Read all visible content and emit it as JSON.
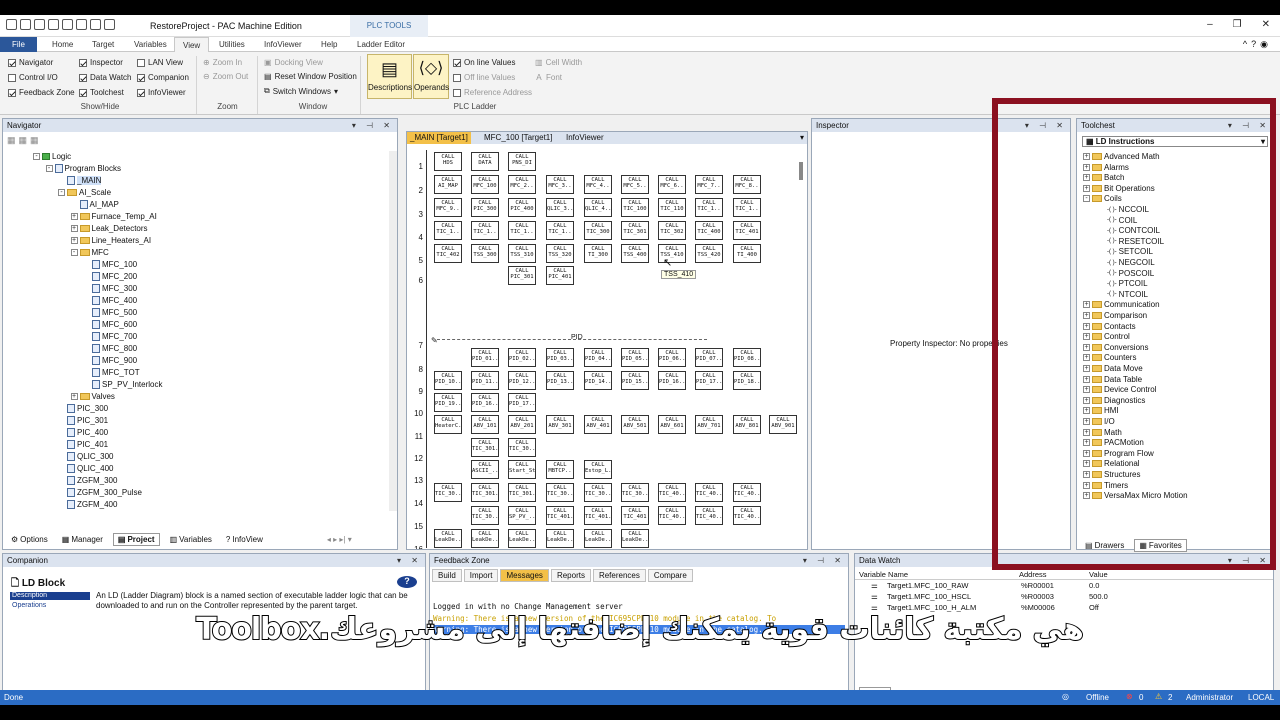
{
  "app": {
    "title": "RestoreProject - PAC Machine Edition",
    "plc_tools": "PLC TOOLS"
  },
  "ribbon_tabs": [
    "File",
    "Home",
    "Target",
    "Variables",
    "View",
    "Utilities",
    "InfoViewer",
    "Help",
    "Ladder Editor"
  ],
  "ribbon": {
    "show_hide": {
      "items": [
        "Navigator",
        "Control I/O",
        "Feedback Zone",
        "Inspector",
        "Data Watch",
        "Toolchest",
        "LAN View",
        "Companion",
        "InfoViewer"
      ],
      "label": "Show/Hide"
    },
    "zoom": {
      "items": [
        "Zoom In",
        "Zoom Out"
      ],
      "label": "Zoom"
    },
    "window": {
      "items": [
        "Docking View",
        "Reset Window Position",
        "Switch Windows"
      ],
      "label": "Window"
    },
    "plc_ladder": {
      "descriptions": "Descriptions",
      "operands": "Operands",
      "items": [
        "On line Values",
        "Off line Values",
        "Reference Address",
        "Cell Width",
        "Font"
      ],
      "label": "PLC Ladder"
    }
  },
  "navigator": {
    "title": "Navigator",
    "items": [
      "Logic",
      "Program Blocks",
      "_MAIN",
      "AI_Scale",
      "AI_MAP",
      "Furnace_Temp_AI",
      "Leak_Detectors",
      "Line_Heaters_AI",
      "MFC",
      "MFC_100",
      "MFC_200",
      "MFC_300",
      "MFC_400",
      "MFC_500",
      "MFC_600",
      "MFC_700",
      "MFC_800",
      "MFC_900",
      "MFC_TOT",
      "SP_PV_Interlock",
      "Valves",
      "PIC_300",
      "PIC_301",
      "PIC_400",
      "PIC_401",
      "QLIC_300",
      "QLIC_400",
      "ZGFM_300",
      "ZGFM_300_Pulse",
      "ZGFM_400"
    ],
    "tabs": [
      "Options",
      "Manager",
      "Project",
      "Variables",
      "InfoView"
    ]
  },
  "ladder": {
    "tabs": [
      "_MAIN [Target1]",
      "MFC_100 [Target1]",
      "InfoViewer"
    ],
    "rungs": [
      "1",
      "2",
      "3",
      "4",
      "5",
      "6",
      "7",
      "8",
      "9",
      "10",
      "11",
      "12",
      "13",
      "14",
      "15",
      "16"
    ],
    "pid_label": "PID",
    "tooltip": "TSS_410",
    "row1": [
      [
        "CALL",
        "HDS"
      ],
      [
        "CALL",
        "DATA"
      ],
      [
        "CALL",
        "PNS_DI"
      ]
    ],
    "row2": [
      "AI_MAP",
      "MFC_100",
      "MFC_2..",
      "MFC_3..",
      "MFC_4..",
      "MFC_5..",
      "MFC_6..",
      "MFC_7..",
      "MFC_8.."
    ],
    "row3": [
      "MFC_9..",
      "PIC_300",
      "PIC_400",
      "QLIC_3..",
      "QLIC_4..",
      "TIC_100",
      "TIC_110",
      "TIC_1..",
      "TIC_1.."
    ],
    "row4": [
      "TIC_1..",
      "TIC_1..",
      "TIC_1..",
      "TIC_1..",
      "TIC_300",
      "TIC_301",
      "TIC_302",
      "TIC_400",
      "TIC_401"
    ],
    "row5": [
      "TIC_402",
      "TSS_300",
      "TSS_310",
      "TSS_320",
      "TI_300",
      "TSS_400",
      "TSS_410",
      "TSS_420",
      "TI_400"
    ],
    "row6": [
      "PIC_301",
      "PIC_401"
    ],
    "row8": [
      "PID_01..",
      "PID_02..",
      "PID_03..",
      "PID_04..",
      "PID_05..",
      "PID_06..",
      "PID_07..",
      "PID_08.."
    ],
    "row9": [
      "PID_10..",
      "PID_11..",
      "PID_12..",
      "PID_13..",
      "PID_14..",
      "PID_15..",
      "PID_16..",
      "PID_17..",
      "PID_18.."
    ],
    "row10": [
      "PID_19..",
      "PID_16..",
      "PID_17.."
    ],
    "row11": [
      "HeaterC..",
      "ABV_101",
      "ABV_201",
      "ABV_301",
      "ABV_401",
      "ABV_501",
      "ABV_601",
      "ABV_701",
      "ABV_801",
      "ABV_901"
    ],
    "row12": [
      "TIC_301..",
      "TIC_30.."
    ],
    "row13": [
      "ASCII_..",
      "Start_St..",
      "MBTCP..",
      "Estop_L.."
    ],
    "row14": [
      "TIC_30..",
      "TIC_301..",
      "TIC_301..",
      "TIC_30..",
      "TIC_30..",
      "TIC_30..",
      "TIC_40..",
      "TIC_40..",
      "TIC_40.."
    ],
    "row15": [
      "TIC_30..",
      "SP_PV_..",
      "TIC_401..",
      "TIC_401..",
      "TIC_401",
      "TIC_40..",
      "TIC_40..",
      "TIC_40.."
    ],
    "row16": [
      "LeakDe..",
      "LeakDe..",
      "LeakDe..",
      "LeakDe..",
      "LeakDe..",
      "LeakDe.."
    ]
  },
  "inspector": {
    "title": "Inspector",
    "message": "Property Inspector: No properties"
  },
  "toolchest": {
    "title": "Toolchest",
    "dropdown": "LD Instructions",
    "items": [
      "Advanced Math",
      "Alarms",
      "Batch",
      "Bit Operations",
      "Coils",
      "NCCOIL",
      "COIL",
      "CONTCOIL",
      "RESETCOIL",
      "SETCOIL",
      "NEGCOIL",
      "POSCOIL",
      "PTCOIL",
      "NTCOIL",
      "Communication",
      "Comparison",
      "Contacts",
      "Control",
      "Conversions",
      "Counters",
      "Data Move",
      "Data Table",
      "Device Control",
      "Diagnostics",
      "HMI",
      "I/O",
      "Math",
      "PACMotion",
      "Program Flow",
      "Relational",
      "Structures",
      "Timers",
      "VersaMax Micro Motion"
    ],
    "tabs": [
      "Drawers",
      "Favorites"
    ]
  },
  "companion": {
    "title": "Companion",
    "heading": "LD Block",
    "links": [
      "Description",
      "Operations"
    ],
    "text": "An LD (Ladder Diagram) block is a named section of executable ladder logic that can be downloaded to and run on the Controller represented by the parent target."
  },
  "feedback": {
    "title": "Feedback Zone",
    "tabs": [
      "Build",
      "Import",
      "Messages",
      "Reports",
      "References",
      "Compare"
    ],
    "messages": [
      "Logged in with no Change Management server",
      "Warning: There is a new version of the IC695CPL410 module in the catalog. To",
      "Warning: There is a new version of the IC695CPL410 module in the catalog. To"
    ]
  },
  "datawatch": {
    "title": "Data Watch",
    "columns": [
      "Variable Name",
      "Address",
      "Value"
    ],
    "rows": [
      [
        "Target1.MFC_100_RAW",
        "%R00001",
        "0.0"
      ],
      [
        "Target1.MFC_100_HSCL",
        "%R00003",
        "500.0"
      ],
      [
        "Target1.MFC_100_H_ALM",
        "%M00006",
        "Off"
      ]
    ],
    "tabs": [
      "Static",
      "Auto"
    ]
  },
  "status": {
    "left": "Done",
    "offline": "Offline",
    "errors": "0",
    "warnings": "2",
    "user": "Administrator",
    "mode": "LOCAL"
  },
  "subtitle": "هي مكتبة كائنات قوية يمكنك إضافتها إلى مشروعك.Toolbox"
}
